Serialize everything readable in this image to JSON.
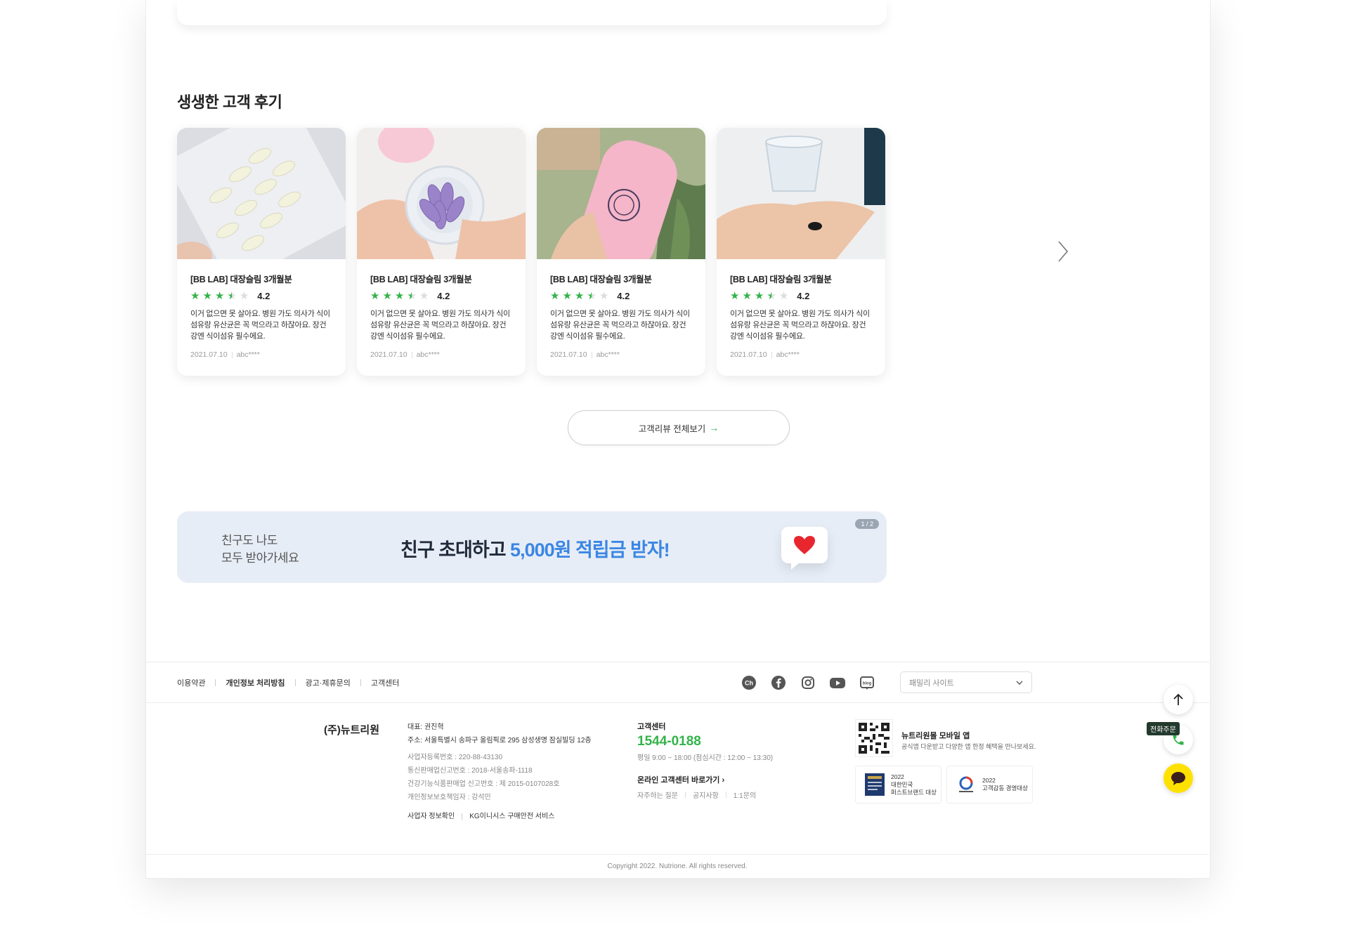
{
  "section": {
    "title": "생생한 고객 후기"
  },
  "reviews": [
    {
      "product": "[BB LAB] 대장슬림 3개월분",
      "rating": 4.2,
      "rating_label": "4.2",
      "text": "이거 없으면 못 살아요. 병원 가도 의사가 식이섬유랑 유산균은 꼭 먹으라고 하잖아요. 장건강엔 식이섬유 필수에요.",
      "date": "2021.07.10",
      "user": "abc****"
    },
    {
      "product": "[BB LAB] 대장슬림 3개월분",
      "rating": 4.2,
      "rating_label": "4.2",
      "text": "이거 없으면 못 살아요. 병원 가도 의사가 식이섬유랑 유산균은 꼭 먹으라고 하잖아요. 장건강엔 식이섬유 필수에요.",
      "date": "2021.07.10",
      "user": "abc****"
    },
    {
      "product": "[BB LAB] 대장슬림 3개월분",
      "rating": 4.2,
      "rating_label": "4.2",
      "text": "이거 없으면 못 살아요. 병원 가도 의사가 식이섬유랑 유산균은 꼭 먹으라고 하잖아요. 장건강엔 식이섬유 필수에요.",
      "date": "2021.07.10",
      "user": "abc****"
    },
    {
      "product": "[BB LAB] 대장슬림 3개월분",
      "rating": 4.2,
      "rating_label": "4.2",
      "text": "이거 없으면 못 살아요. 병원 가도 의사가 식이섬유랑 유산균은 꼭 먹으라고 하잖아요. 장건강엔 식이섬유 필수에요.",
      "date": "2021.07.10",
      "user": "abc****"
    }
  ],
  "more_button": {
    "label": "고객리뷰 전체보기",
    "arrow": "→"
  },
  "banner": {
    "sub_line1": "친구도 나도",
    "sub_line2": "모두 받아가세요",
    "main_prefix": "친구 초대하고 ",
    "main_highlight": "5,000원 적립금 받자!",
    "pager": "1 / 2",
    "icon": "heart-icon"
  },
  "footer": {
    "links": [
      "이용약관",
      "개인정보 처리방침",
      "광고·제휴문의",
      "고객센터"
    ],
    "social_icons": [
      "channel-icon",
      "facebook-icon",
      "instagram-icon",
      "youtube-icon",
      "blog-icon"
    ],
    "family_site": "패밀리 사이트",
    "company": "(주)뉴트리원",
    "info": {
      "ceo": "대표: 권진혁",
      "address": "주소: 서울특별시 송파구 올림픽로 295 삼성생명 잠실빌딩 12층",
      "biz_no": "사업자등록번호 : 220-88-43130",
      "mail_order": "통신판매업신고번호 : 2018-서울송파-1118",
      "health_food": "건강기능식품판매업 신고번호 : 제 2015-0107028호",
      "privacy_officer": "개인정보보호책임자 : 강석민",
      "link1": "사업자 정보확인",
      "link2": "KG이니시스 구매안전 서비스"
    },
    "cs": {
      "label": "고객센터",
      "tel": "1544-0188",
      "hours": "평일 9:00 ~ 18:00 (점심시간 : 12:00 ~ 13:30)",
      "online": "온라인 고객센터 바로가기",
      "online_arrow": "›",
      "sublinks": [
        "자주하는 질문",
        "공지사항",
        "1:1문의"
      ]
    },
    "app": {
      "title": "뉴트리원몰 모바일 앱",
      "desc": "공식앱 다운받고 다양한 앱 한정 혜택을 만나보세요."
    },
    "awards": [
      {
        "year": "2022",
        "line1": "대한민국",
        "line2": "퍼스트브랜드 대상"
      },
      {
        "year": "2022",
        "line1": "고객감동 경영대상",
        "line2": ""
      }
    ],
    "copyright": "Copyright 2022. Nutrione. All rights reserved."
  },
  "floating": {
    "phone_tag": "전화주문"
  },
  "colors": {
    "accent_green": "#33b34a",
    "banner_blue": "#3b86e4",
    "banner_bg": "#e7edf6",
    "kakao_yellow": "#ffe100"
  }
}
